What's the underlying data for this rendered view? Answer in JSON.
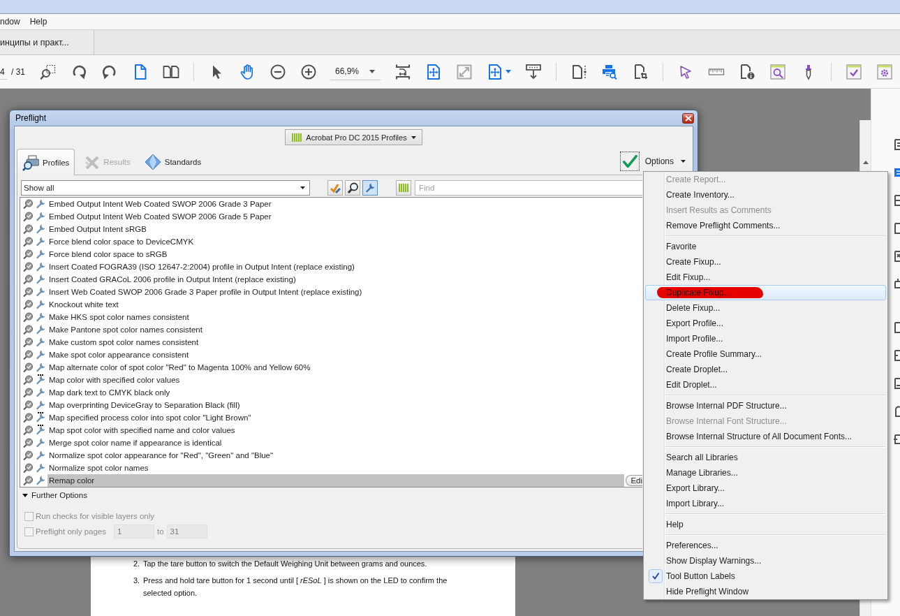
{
  "app_window": {
    "menu": [
      "ndow",
      "Help"
    ],
    "document_tab": "инципы и практ..."
  },
  "toolbar": {
    "page_number": "4",
    "page_count": "/ 31",
    "zoom": "66,9%"
  },
  "preflight": {
    "title": "Preflight",
    "profile_set": "Acrobat Pro DC 2015 Profiles",
    "tabs": [
      {
        "label": "Profiles",
        "selected": true,
        "disabled": false
      },
      {
        "label": "Results",
        "selected": false,
        "disabled": true
      },
      {
        "label": "Standards",
        "selected": false,
        "disabled": false
      }
    ],
    "options_label": "Options",
    "filter": {
      "value": "Show all"
    },
    "filter_buttons": [
      {
        "kind": "checks",
        "selected": false
      },
      {
        "kind": "search",
        "selected": false
      },
      {
        "kind": "fixups",
        "selected": true
      }
    ],
    "find": {
      "placeholder": "Find"
    },
    "profiles": [
      {
        "label": "Embed Output Intent Web Coated SWOP 2006 Grade 3 Paper",
        "kind": "standard",
        "selected": false
      },
      {
        "label": "Embed Output Intent Web Coated SWOP 2006 Grade 5 Paper",
        "kind": "standard",
        "selected": false
      },
      {
        "label": "Embed Output Intent sRGB",
        "kind": "standard",
        "selected": false
      },
      {
        "label": "Force blend color space to DeviceCMYK",
        "kind": "standard",
        "selected": false
      },
      {
        "label": "Force blend color space to sRGB",
        "kind": "standard",
        "selected": false
      },
      {
        "label": "Insert Coated FOGRA39 (ISO 12647-2:2004) profile in Output Intent (replace existing)",
        "kind": "standard",
        "selected": false
      },
      {
        "label": "Insert Coated GRACoL 2006 profile in Output Intent (replace existing)",
        "kind": "standard",
        "selected": false
      },
      {
        "label": "Insert Web Coated SWOP 2006 Grade 3 Paper profile in Output Intent (replace existing)",
        "kind": "standard",
        "selected": false
      },
      {
        "label": "Knockout white text",
        "kind": "standard",
        "selected": false
      },
      {
        "label": "Make HKS spot color names consistent",
        "kind": "standard",
        "selected": false
      },
      {
        "label": "Make Pantone spot color names consistent",
        "kind": "standard",
        "selected": false
      },
      {
        "label": "Make custom spot color names consistent",
        "kind": "standard",
        "selected": false
      },
      {
        "label": "Make spot color appearance consistent",
        "kind": "standard",
        "selected": false
      },
      {
        "label": "Map alternate color of spot color \"Red\" to Magenta 100% and Yellow 60%",
        "kind": "standard",
        "selected": false
      },
      {
        "label": "Map color with specified color values",
        "kind": "dotted",
        "selected": false
      },
      {
        "label": "Map dark text to CMYK black only",
        "kind": "standard",
        "selected": false
      },
      {
        "label": "Map overprinting DeviceGray to Separation Black (fill)",
        "kind": "standard",
        "selected": false
      },
      {
        "label": "Map specified process color into spot color \"Light Brown\"",
        "kind": "dotted",
        "selected": false
      },
      {
        "label": "Map spot color with specified name and color values",
        "kind": "dotted",
        "selected": false
      },
      {
        "label": "Merge spot color name if appearance is identical",
        "kind": "standard",
        "selected": false
      },
      {
        "label": "Normalize spot color appearance for \"Red\", \"Green\" and \"Blue\"",
        "kind": "standard",
        "selected": false
      },
      {
        "label": "Normalize spot color names",
        "kind": "standard",
        "selected": false
      },
      {
        "label": "Remap color",
        "kind": "standard",
        "selected": true,
        "button": "Edi"
      }
    ],
    "further_options": {
      "label": "Further Options",
      "expanded": true,
      "visible_layers": {
        "label": "Run checks for visible layers only",
        "checked": false,
        "disabled": true
      },
      "page_range": {
        "label": "Preflight only pages",
        "checked": false,
        "disabled": true,
        "from": "1",
        "to_label": "to",
        "to": "31"
      }
    }
  },
  "options_menu": {
    "groups": [
      [
        {
          "label": "Create Report...",
          "disabled": true,
          "checked": false,
          "selected": false,
          "marked": false
        },
        {
          "label": "Create Inventory...",
          "disabled": false,
          "checked": false,
          "selected": false,
          "marked": false
        },
        {
          "label": "Insert Results as Comments",
          "disabled": true,
          "checked": false,
          "selected": false,
          "marked": false
        },
        {
          "label": "Remove Preflight Comments...",
          "disabled": false,
          "checked": false,
          "selected": false,
          "marked": false
        }
      ],
      [
        {
          "label": "Favorite",
          "disabled": false,
          "checked": false,
          "selected": false,
          "marked": false
        },
        {
          "label": "Create Fixup...",
          "disabled": false,
          "checked": false,
          "selected": false,
          "marked": false
        },
        {
          "label": "Edit Fixup...",
          "disabled": false,
          "checked": false,
          "selected": false,
          "marked": false
        },
        {
          "label": "Duplicate Fixup...",
          "disabled": false,
          "checked": false,
          "selected": true,
          "marked": true
        },
        {
          "label": "Delete Fixup...",
          "disabled": false,
          "checked": false,
          "selected": false,
          "marked": false
        },
        {
          "label": "Export Profile...",
          "disabled": false,
          "checked": false,
          "selected": false,
          "marked": false
        },
        {
          "label": "Import Profile...",
          "disabled": false,
          "checked": false,
          "selected": false,
          "marked": false
        },
        {
          "label": "Create Profile Summary...",
          "disabled": false,
          "checked": false,
          "selected": false,
          "marked": false
        },
        {
          "label": "Create Droplet...",
          "disabled": false,
          "checked": false,
          "selected": false,
          "marked": false
        },
        {
          "label": "Edit Droplet...",
          "disabled": false,
          "checked": false,
          "selected": false,
          "marked": false
        }
      ],
      [
        {
          "label": "Browse Internal PDF Structure...",
          "disabled": false,
          "checked": false,
          "selected": false,
          "marked": false
        },
        {
          "label": "Browse Internal Font Structure...",
          "disabled": true,
          "checked": false,
          "selected": false,
          "marked": false
        },
        {
          "label": "Browse Internal Structure of All Document Fonts...",
          "disabled": false,
          "checked": false,
          "selected": false,
          "marked": false
        }
      ],
      [
        {
          "label": "Search all Libraries",
          "disabled": false,
          "checked": false,
          "selected": false,
          "marked": false
        },
        {
          "label": "Manage Libraries...",
          "disabled": false,
          "checked": false,
          "selected": false,
          "marked": false
        },
        {
          "label": "Export Library...",
          "disabled": false,
          "checked": false,
          "selected": false,
          "marked": false
        },
        {
          "label": "Import Library...",
          "disabled": false,
          "checked": false,
          "selected": false,
          "marked": false
        }
      ],
      [
        {
          "label": "Help",
          "disabled": false,
          "checked": false,
          "selected": false,
          "marked": false
        }
      ],
      [
        {
          "label": "Preferences...",
          "disabled": false,
          "checked": false,
          "selected": false,
          "marked": false
        },
        {
          "label": "Show Display Warnings...",
          "disabled": false,
          "checked": false,
          "selected": false,
          "marked": false
        },
        {
          "label": "Tool Button Labels",
          "disabled": false,
          "checked": true,
          "selected": false,
          "marked": false
        },
        {
          "label": "Hide Preflight Window",
          "disabled": false,
          "checked": false,
          "selected": false,
          "marked": false
        }
      ]
    ]
  },
  "document": {
    "items": [
      {
        "number": "2.",
        "text": "Tap the tare button to switch the Default Weighing Unit between grams and ounces."
      },
      {
        "number": "3.",
        "text": "Press and hold tare button for 1 second until [ *rESoL* ] is shown on the LED to confirm the selected option."
      }
    ]
  }
}
